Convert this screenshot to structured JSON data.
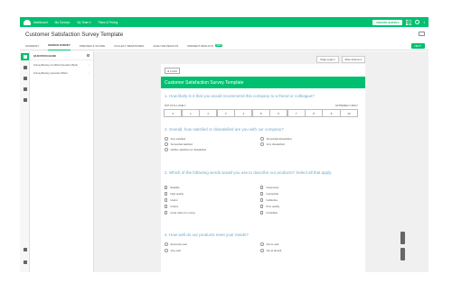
{
  "topnav": {
    "links": [
      "Dashboard",
      "My Surveys",
      "My Team ▾",
      "Plans & Pricing"
    ],
    "create_label": "CREATE SURVEY",
    "user_label": "▾"
  },
  "titlebar": {
    "title": "Customer Satisfaction Survey Template"
  },
  "tabs": {
    "items": [
      "SUMMARY",
      "DESIGN SURVEY",
      "PREVIEW & SCORE",
      "COLLECT RESPONSES",
      "ANALYZE RESULTS",
      "PRESENT RESULTS"
    ],
    "badge": "NEW",
    "next_label": "NEXT"
  },
  "bank": {
    "title": "QUESTION BANK",
    "rows": [
      "SurveyMonkey Certified Question Bank",
      "SurveyMonkey Question Bank"
    ]
  },
  "toolbar": {
    "page_logic": "Page Logic ▾",
    "more_actions": "More Actions ▾"
  },
  "survey": {
    "logo_label": "⊕ LOGO",
    "title": "Customer Satisfaction Survey Template",
    "q1": {
      "text": "1. How likely is it that you would recommend this company to a friend or colleague?",
      "low_label": "NOT AT ALL LIKELY",
      "high_label": "EXTREMELY LIKELY",
      "scale": [
        "0",
        "1",
        "2",
        "3",
        "4",
        "5",
        "6",
        "7",
        "8",
        "9",
        "10"
      ]
    },
    "q2": {
      "text": "2. Overall, how satisfied or dissatisfied are you with our company?",
      "options": [
        "Very satisfied",
        "Somewhat satisfied",
        "Neither satisfied nor dissatisfied",
        "Somewhat dissatisfied",
        "Very dissatisfied"
      ]
    },
    "q3": {
      "text": "3. Which of the following words would you use to describe our products? Select all that apply.",
      "options_left": [
        "Reliable",
        "High quality",
        "Useful",
        "Unique",
        "Good value for money"
      ],
      "options_right": [
        "Overpriced",
        "Impractical",
        "Ineffective",
        "Poor quality",
        "Unreliable"
      ]
    },
    "q4": {
      "text": "4. How well do our products meet your needs?",
      "options_left": [
        "Extremely well",
        "Very well"
      ],
      "options_right": [
        "Not so well",
        "Not at all well"
      ]
    }
  },
  "colors": {
    "brand": "#00bf6f",
    "question": "#6fa8c7",
    "canvas": "#f0f0f0"
  }
}
